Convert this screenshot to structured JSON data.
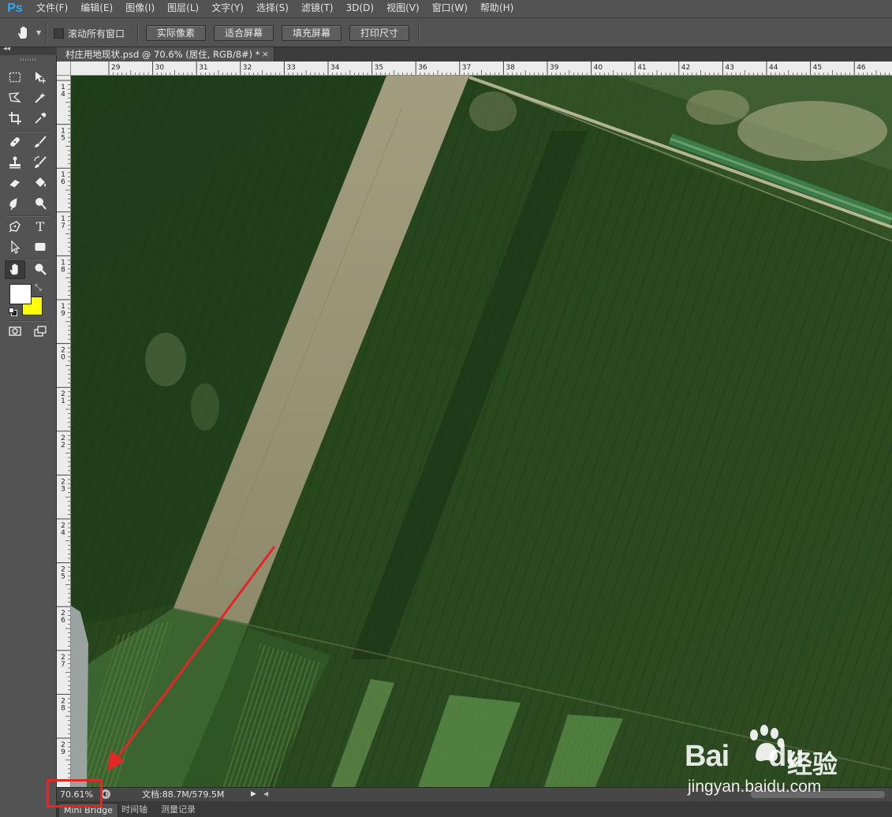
{
  "app": {
    "logo": "Ps"
  },
  "menu": [
    "文件(F)",
    "编辑(E)",
    "图像(I)",
    "图层(L)",
    "文字(Y)",
    "选择(S)",
    "滤镜(T)",
    "3D(D)",
    "视图(V)",
    "窗口(W)",
    "帮助(H)"
  ],
  "options": {
    "tool_icon": "hand-icon",
    "scroll_all_label": "滚动所有窗口",
    "scroll_all_checked": false,
    "buttons": [
      "实际像素",
      "适合屏幕",
      "填充屏幕",
      "打印尺寸"
    ]
  },
  "document": {
    "tab_title": "村庄用地现状.psd @ 70.6% (居住, RGB/8#) *",
    "close": "×"
  },
  "rulers": {
    "top": [
      "29",
      "30",
      "31",
      "32",
      "33",
      "34",
      "35",
      "36",
      "37",
      "38",
      "39",
      "40",
      "41",
      "42",
      "43",
      "44",
      "45",
      "46"
    ],
    "left": [
      "14",
      "15",
      "16",
      "17",
      "18",
      "19",
      "20",
      "21",
      "22",
      "23",
      "24",
      "25",
      "26",
      "27",
      "28",
      "29"
    ]
  },
  "tools": [
    "rectangular-marquee-icon",
    "move-icon",
    "lasso-icon",
    "magic-wand-icon",
    "crop-icon",
    "eyedropper-icon",
    "healing-brush-icon",
    "brush-icon",
    "clone-stamp-icon",
    "history-brush-icon",
    "eraser-icon",
    "paint-bucket-icon",
    "blur-icon",
    "dodge-icon",
    "pen-icon",
    "type-icon",
    "path-selection-icon",
    "rectangle-shape-icon",
    "hand-icon",
    "zoom-icon"
  ],
  "colors": {
    "foreground": "#ffffff",
    "background": "#ffff00",
    "annotation": "#e42626",
    "ps_blue": "#31a8ff"
  },
  "status": {
    "zoom": "70.61%",
    "doc_info": "文档:88.7M/579.5M"
  },
  "bottom_tabs": [
    "Mini Bridge",
    "时间轴",
    "测量记录"
  ],
  "watermark": {
    "brand": "Bai",
    "brand_du": "du",
    "jingyan": "经验",
    "url": "jingyan.baidu.com"
  }
}
